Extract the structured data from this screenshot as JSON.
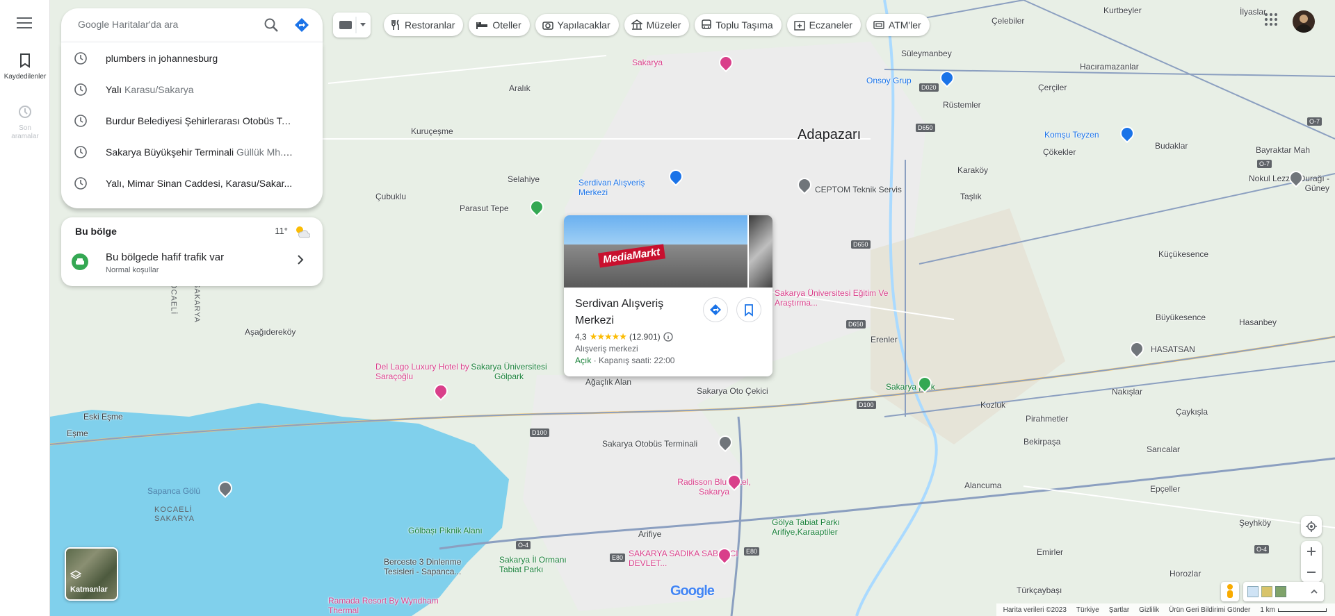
{
  "rail": {
    "saved_label": "Kaydedilenler",
    "recent_label_1": "Son",
    "recent_label_2": "aramalar"
  },
  "search": {
    "placeholder": "Google Haritalar'da ara"
  },
  "history": [
    {
      "main": "plumbers in johannesburg",
      "sub": ""
    },
    {
      "main": "Yalı",
      "sub": "Karasu/Sakarya"
    },
    {
      "main": "Burdur Belediyesi Şehirlerarası Otobüs Te...",
      "sub": ""
    },
    {
      "main": "Sakarya Büyükşehir Terminali",
      "sub": "Güllük Mh.,..."
    },
    {
      "main": "Yalı, Mimar Sinan Caddesi, Karasu/Sakar...",
      "sub": ""
    }
  ],
  "region": {
    "title": "Bu bölge",
    "temp": "11°",
    "traffic": "Bu bölgede hafif trafik var",
    "traffic_sub": "Normal koşullar"
  },
  "chips": [
    {
      "label": "Restoranlar",
      "icon": "fork-knife-icon"
    },
    {
      "label": "Oteller",
      "icon": "bed-icon"
    },
    {
      "label": "Yapılacaklar",
      "icon": "camera-icon"
    },
    {
      "label": "Müzeler",
      "icon": "museum-icon"
    },
    {
      "label": "Toplu Taşıma",
      "icon": "bus-icon"
    },
    {
      "label": "Eczaneler",
      "icon": "pharmacy-icon"
    },
    {
      "label": "ATM'ler",
      "icon": "atm-icon"
    }
  ],
  "place": {
    "name": "Serdivan Alışveriş Merkezi",
    "rating": "4,3",
    "reviews": "(12.901)",
    "category": "Alışveriş merkezi",
    "open": "Açık",
    "hours": "· Kapanış saati: 22:00",
    "photo_sign": "MediaMarkt"
  },
  "layers": {
    "label": "Katmanlar"
  },
  "attribution": {
    "data": "Harita verileri ©2023",
    "country": "Türkiye",
    "terms": "Şartlar",
    "privacy": "Gizlilik",
    "feedback": "Ürün Geri Bildirimi Gönder",
    "scale": "1 km"
  },
  "logo": "Google",
  "map_labels": {
    "city": "Adapazarı",
    "towns": [
      "Çelebiler",
      "Kurtbeyler",
      "İlyaslar",
      "Süleymanbey",
      "Hacıramazanlar",
      "Çerçiler",
      "Rüstemler",
      "Aralık",
      "Kuruçeşme",
      "Selahiye",
      "Çubuklu",
      "Parasut Tepe",
      "Çökekler",
      "Budaklar",
      "Karaköy",
      "Taşlık",
      "Küçükesence",
      "Büyükesence",
      "Hasanbey",
      "Erenler",
      "Nakışlar",
      "Kozluk",
      "Pirahmetler",
      "Çaykışla",
      "Bekirpaşa",
      "Sarıcalar",
      "Alancuma",
      "Epçeller",
      "Şeyhköy",
      "Emirler",
      "Horozlar",
      "Türkçaybaşı",
      "Arifiye",
      "Aşağıdereköy",
      "Eski Eşme",
      "Eşme",
      "Ağaçlık Alan"
    ],
    "pois": [
      {
        "name": "Sakarya",
        "color": "#d93f8a"
      },
      {
        "name": "Onsoy Grup",
        "color": "#1a73e8"
      },
      {
        "name": "Komşu Teyzen",
        "color": "#1a73e8"
      },
      {
        "name": "Bayraktar Mah",
        "color": "#3c4043"
      },
      {
        "name": "Nokul Lezzet Durağı - Güney",
        "color": "#3c4043"
      },
      {
        "name": "Serdivan Alışveriş Merkezi",
        "color": "#1a73e8"
      },
      {
        "name": "CEPTOM Teknik Servis",
        "color": "#3c4043"
      },
      {
        "name": "Sakarya Üniversitesi Eğitim Ve Araştırma...",
        "color": "#d93f8a"
      },
      {
        "name": "HASATSAN",
        "color": "#3c4043"
      },
      {
        "name": "Sakarya park",
        "color": "#188038"
      },
      {
        "name": "Del Lago Luxury Hotel by Saraçoğlu",
        "color": "#d93f8a"
      },
      {
        "name": "Sakarya Üniversitesi Gölpark",
        "color": "#188038"
      },
      {
        "name": "Sakarya Oto Çekici",
        "color": "#3c4043"
      },
      {
        "name": "Sakarya Otobüs Terminali",
        "color": "#3c4043"
      },
      {
        "name": "Radisson Blu Hotel, Sakarya",
        "color": "#d93f8a"
      },
      {
        "name": "Gölya Tabiat Parkı Arifiye,Karaaptiler",
        "color": "#188038"
      },
      {
        "name": "Gölbaşı Piknik Alanı",
        "color": "#188038"
      },
      {
        "name": "Sakarya İl Ormanı Tabiat Parkı",
        "color": "#188038"
      },
      {
        "name": "Berceste 3 Dinlenme Tesisleri - Sapanca...",
        "color": "#3c4043"
      },
      {
        "name": "SAKARYA SADIKA SABANCI DEVLET...",
        "color": "#d93f8a"
      },
      {
        "name": "Ramada Resort By Wyndham Thermal",
        "color": "#d93f8a"
      },
      {
        "name": "Sapanca Gölü",
        "color": "#4f7fa8"
      }
    ],
    "roads": [
      "D020",
      "D650",
      "D650",
      "D650",
      "D100",
      "D100",
      "E80",
      "E80",
      "O-4",
      "O-4",
      "O-7",
      "O-7"
    ],
    "borders": [
      "KOCAELİ",
      "SAKARYA",
      "KOCAELİ",
      "SAKARYA"
    ]
  }
}
